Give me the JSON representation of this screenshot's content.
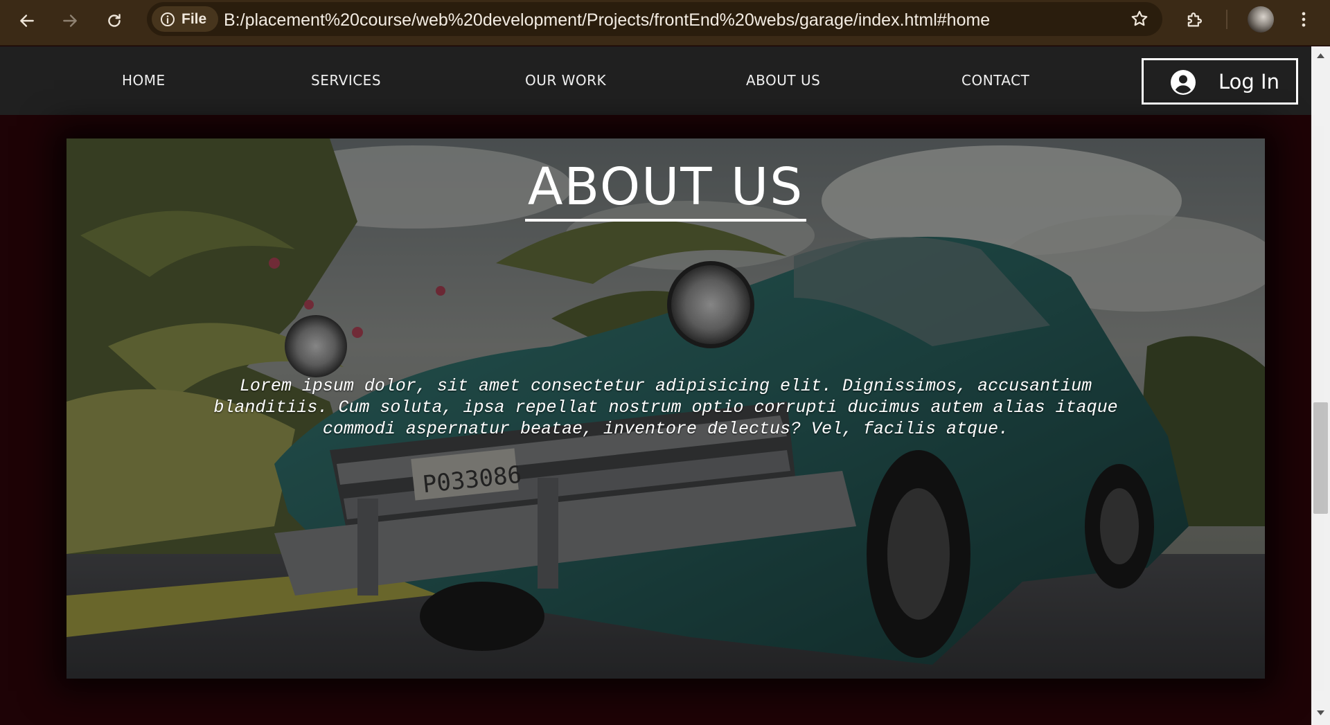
{
  "browser": {
    "site_chip_label": "File",
    "url": "B:/placement%20course/web%20development/Projects/frontEnd%20webs/garage/index.html#home",
    "icons": {
      "back": "arrow-left-icon",
      "forward": "arrow-right-icon",
      "reload": "reload-icon",
      "info": "info-icon",
      "bookmark": "star-icon",
      "extensions": "puzzle-icon",
      "menu": "kebab-menu-icon"
    }
  },
  "navbar": {
    "links": [
      {
        "label": "HOME"
      },
      {
        "label": "SERVICES"
      },
      {
        "label": "OUR WORK"
      },
      {
        "label": "ABOUT US"
      },
      {
        "label": "CONTACT"
      }
    ],
    "login_label": "Log In",
    "login_icon": "user-circle-icon"
  },
  "about": {
    "title": "ABOUT US",
    "body": "Lorem ipsum dolor, sit amet consectetur adipisicing elit. Dignissimos, accusantium blanditiis. Cum soluta, ipsa repellat nostrum optio corrupti ducimus autem alias itaque commodi aspernatur beatae, inventore delectus? Vel, facilis atque.",
    "background_image": "vintage-teal-car-photo",
    "license_plate": "P033086"
  },
  "colors": {
    "page_background": "#1e0306",
    "navbar": "#202020",
    "browser_chrome": "#3b2a16",
    "car_teal": "#2d6a67"
  }
}
